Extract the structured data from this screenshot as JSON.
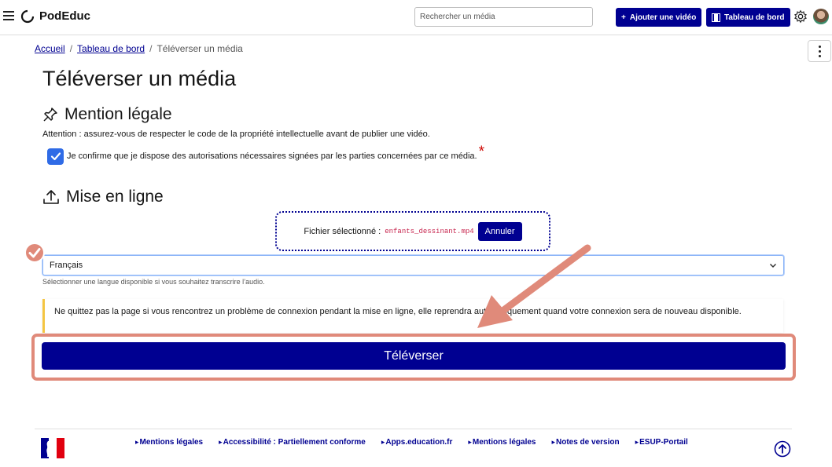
{
  "header": {
    "brand": "PodEduc",
    "search_placeholder": "Rechercher un média",
    "add_video_label": "Ajouter une vidéo",
    "dashboard_label": "Tableau de bord"
  },
  "breadcrumb": {
    "home": "Accueil",
    "dashboard": "Tableau de bord",
    "current": "Téléverser un média"
  },
  "page": {
    "title": "Téléverser un média",
    "legal_section": "Mention légale",
    "legal_notice": "Attention : assurez-vous de respecter le code de la propriété intellectuelle avant de publier une vidéo.",
    "consent_label": "Je confirme que je dispose des autorisations nécessaires signées par les parties concernées par ce média.",
    "consent_checked": true,
    "required_mark": "*",
    "upload_section": "Mise en ligne",
    "file_selected_label": "Fichier sélectionné :",
    "file_name": "enfants_dessinant.mp4",
    "cancel_label": "Annuler",
    "language_value": "Français",
    "language_help": "Sélectionner une langue disponible si vous souhaitez transcrire l’audio.",
    "warning_text": "Ne quittez pas la page si vous rencontrez un problème de connexion pendant la mise en ligne, elle reprendra automatiquement quand votre connexion sera de nouveau disponible.",
    "upload_button": "Téléverser"
  },
  "footer": {
    "links": [
      "Mentions légales",
      "Accessibilité : Partiellement conforme",
      "Apps.education.fr",
      "Mentions légales",
      "Notes de version",
      "ESUP-Portail"
    ]
  },
  "colors": {
    "primary": "#000091",
    "annotation": "#e08a7a",
    "checkbox": "#2f6be6",
    "warning_border": "#f4c542"
  },
  "icons": [
    "menu-icon",
    "logo-icon",
    "plus-icon",
    "film-icon",
    "gear-icon",
    "kebab-icon",
    "pin-icon",
    "upload-icon",
    "check-icon",
    "chevron-down-icon",
    "arrow-up-icon",
    "checkmark-badge-icon",
    "annotation-arrow"
  ]
}
